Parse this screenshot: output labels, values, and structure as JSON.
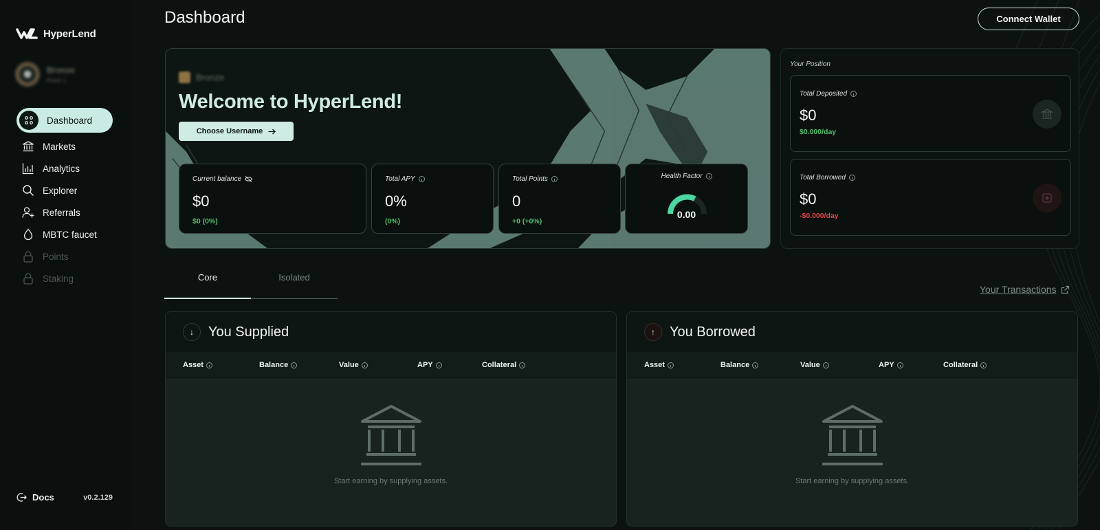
{
  "app": {
    "name": "HyperLend",
    "page_title": "Dashboard",
    "version": "v0.2.129"
  },
  "rank": {
    "tier": "Bronze",
    "subtitle": "Rank 1"
  },
  "sidebar": {
    "items": [
      {
        "label": "Dashboard",
        "icon": "grid-icon",
        "active": true,
        "locked": false
      },
      {
        "label": "Markets",
        "icon": "bank-icon",
        "active": false,
        "locked": false
      },
      {
        "label": "Analytics",
        "icon": "bar-chart-icon",
        "active": false,
        "locked": false
      },
      {
        "label": "Explorer",
        "icon": "search-icon",
        "active": false,
        "locked": false
      },
      {
        "label": "Referrals",
        "icon": "user-plus-icon",
        "active": false,
        "locked": false
      },
      {
        "label": "MBTC faucet",
        "icon": "faucet-icon",
        "active": false,
        "locked": false
      },
      {
        "label": "Points",
        "icon": "lock-icon",
        "active": false,
        "locked": true
      },
      {
        "label": "Staking",
        "icon": "lock-icon",
        "active": false,
        "locked": true
      }
    ],
    "docs_label": "Docs"
  },
  "header": {
    "connect_label": "Connect Wallet"
  },
  "hero": {
    "badge": "Bronze",
    "welcome": "Welcome to HyperLend!",
    "username_button": "Choose Username",
    "stats": {
      "balance": {
        "label": "Current balance",
        "value": "$0",
        "sub": "$0 (0%)"
      },
      "apy": {
        "label": "Total APY",
        "value": "0%",
        "sub": "(0%)"
      },
      "points": {
        "label": "Total Points",
        "value": "0",
        "sub": "+0 (+0%)"
      },
      "health": {
        "label": "Health Factor",
        "value": "0.00",
        "level": 0.65
      }
    }
  },
  "position": {
    "title": "Your Position",
    "deposited": {
      "label": "Total Deposited",
      "value": "$0",
      "sub": "$0.000/day",
      "icon": "vault-icon"
    },
    "borrowed": {
      "label": "Total Borrowed",
      "value": "$0",
      "sub": "-$0.000/day",
      "icon": "borrow-icon"
    }
  },
  "tabs": [
    {
      "label": "Core",
      "active": true
    },
    {
      "label": "Isolated",
      "active": false
    }
  ],
  "transactions_link": "Your Transactions",
  "supplied": {
    "title": "You Supplied",
    "columns": [
      "Asset",
      "Balance",
      "Value",
      "APY",
      "Collateral"
    ],
    "empty": "Start earning by supplying assets."
  },
  "borrowed": {
    "title": "You Borrowed",
    "columns": [
      "Asset",
      "Balance",
      "Value",
      "APY",
      "Collateral"
    ],
    "empty": "Start earning by supplying assets."
  },
  "colors": {
    "accent": "#c9ebe3",
    "positive": "#54c06c",
    "negative": "#e04848",
    "background": "#0b1210"
  }
}
